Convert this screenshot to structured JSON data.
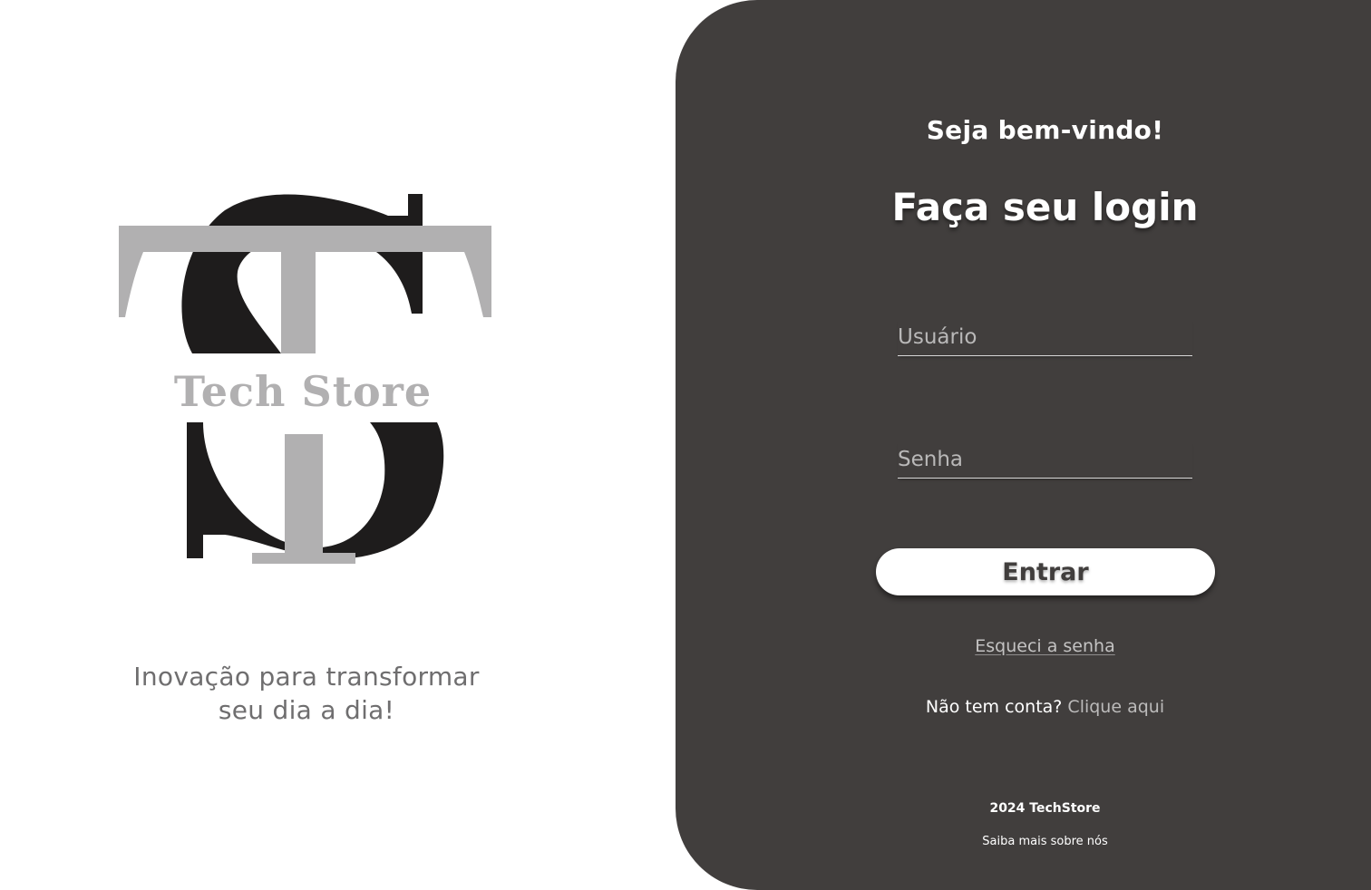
{
  "brand": {
    "logo_text": "Tech Store",
    "tagline_line1": "Inovação para transformar",
    "tagline_line2": "seu dia a dia!"
  },
  "login": {
    "welcome": "Seja bem-vindo!",
    "title": "Faça seu login",
    "username_placeholder": "Usuário",
    "username_value": "",
    "password_placeholder": "Senha",
    "password_value": "",
    "submit_label": "Entrar",
    "forgot_password_label": "Esqueci a senha",
    "no_account_text": "Não tem conta?",
    "signup_link_label": "Clique aqui"
  },
  "footer": {
    "copyright": "2024 TechStore",
    "about_link_label": "Saiba mais sobre nós"
  },
  "colors": {
    "panel_background": "#413e3d",
    "logo_dark": "#1e1c1c",
    "logo_light": "#b1b0b1",
    "tagline": "#6f6e6f"
  }
}
